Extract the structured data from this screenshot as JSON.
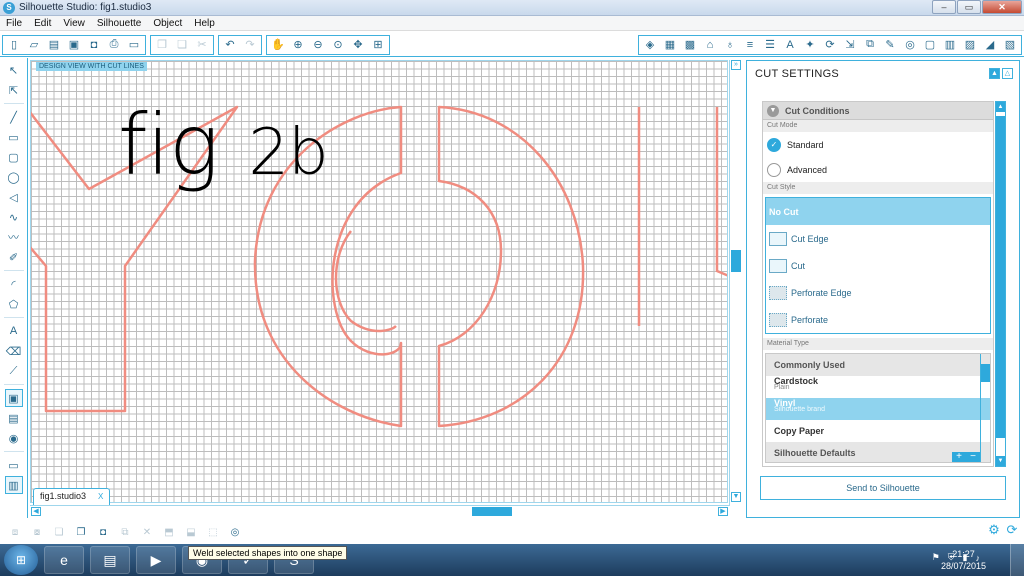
{
  "window": {
    "title": "Silhouette Studio: fig1.studio3",
    "min": "–",
    "max": "▭",
    "close": "✕"
  },
  "menu": [
    "File",
    "Edit",
    "View",
    "Silhouette",
    "Object",
    "Help"
  ],
  "canvas": {
    "mode_label": "DESIGN VIEW WITH CUT LINES",
    "overlay_text_left": "fig",
    "overlay_text_right": "2b",
    "doc_tab": "fig1.studio3",
    "doc_tab_close": "X",
    "cut_line_color": "#f08c80"
  },
  "panel": {
    "title": "CUT SETTINGS",
    "cut_conditions": "Cut Conditions",
    "cut_mode_label": "Cut Mode",
    "modes": [
      {
        "label": "Standard",
        "selected": true
      },
      {
        "label": "Advanced",
        "selected": false
      }
    ],
    "cut_style_label": "Cut Style",
    "styles": [
      {
        "label": "No Cut",
        "selected": true
      },
      {
        "label": "Cut Edge",
        "selected": false
      },
      {
        "label": "Cut",
        "selected": false
      },
      {
        "label": "Perforate Edge",
        "selected": false
      },
      {
        "label": "Perforate",
        "selected": false
      }
    ],
    "material_type_label": "Material Type",
    "material_group_1": "Commonly Used",
    "materials": [
      {
        "name": "Cardstock",
        "sub": "Plain",
        "selected": false
      },
      {
        "name": "Vinyl",
        "sub": "Silhouette brand",
        "selected": true
      },
      {
        "name": "Copy Paper",
        "sub": "",
        "selected": false
      }
    ],
    "material_group_2": "Silhouette Defaults",
    "send_button": "Send to Silhouette"
  },
  "tooltip": "Weld selected shapes into one shape",
  "taskbar": {
    "time": "21:27",
    "date": "28/07/2015"
  },
  "accent": "#2ea9dc"
}
